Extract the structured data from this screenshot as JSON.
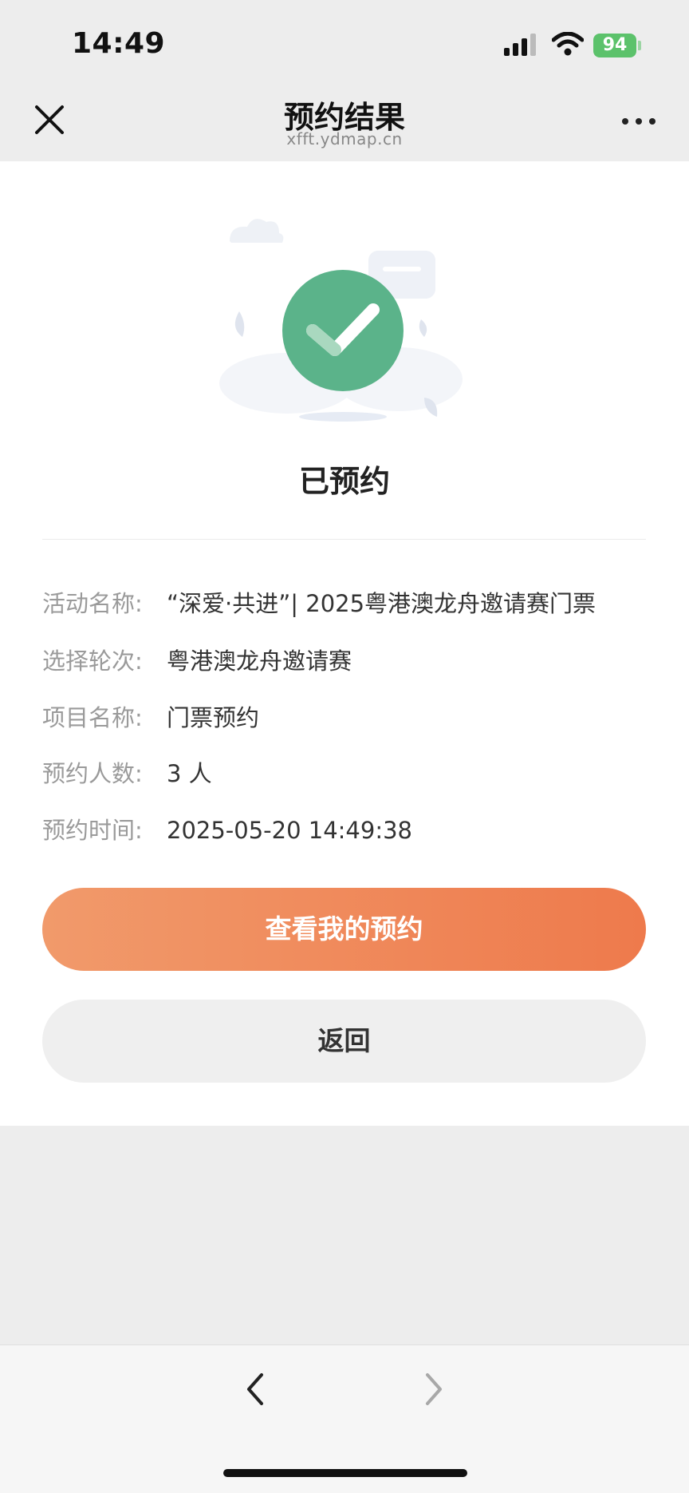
{
  "status_bar": {
    "time": "14:49",
    "battery": "94"
  },
  "navbar": {
    "title": "预约结果",
    "subtitle": "xfft.ydmap.cn"
  },
  "result": {
    "title": "已预约"
  },
  "details": [
    {
      "label": "活动名称:",
      "value": "“深爱·共进”| 2025粤港澳龙舟邀请赛门票"
    },
    {
      "label": "选择轮次:",
      "value": "粤港澳龙舟邀请赛"
    },
    {
      "label": "项目名称:",
      "value": "门票预约"
    },
    {
      "label": "预约人数:",
      "value": "3 人"
    },
    {
      "label": "预约时间:",
      "value": "2025-05-20 14:49:38"
    }
  ],
  "buttons": {
    "primary": "查看我的预约",
    "secondary": "返回"
  },
  "colors": {
    "accent_start": "#f19a6b",
    "accent_end": "#ee7a4c",
    "success": "#5bb38a"
  }
}
